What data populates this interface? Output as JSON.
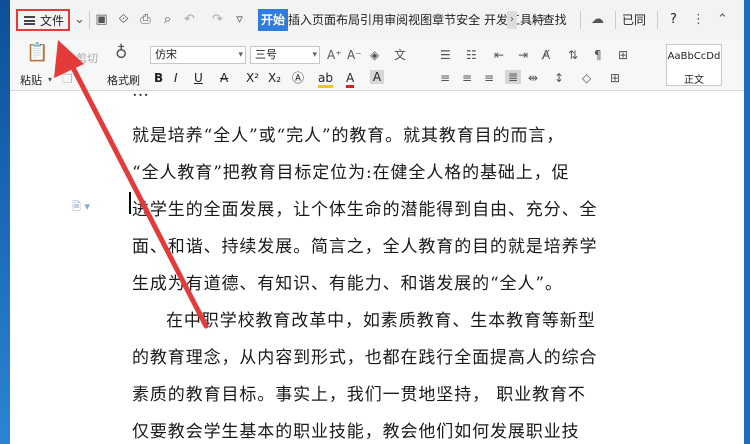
{
  "menubar": {
    "file_label": "文件",
    "tabs": [
      "插入",
      "页面布局",
      "引用",
      "审阅",
      "视图",
      "章节",
      "安全",
      "开发工具",
      "特"
    ],
    "active_tab": "开始",
    "search_label": "查找",
    "sync_label": "已同",
    "help": "?",
    "icons": [
      "menu-icon",
      "save-icon",
      "template-icon",
      "print-icon",
      "preview-icon",
      "undo-icon",
      "redo-icon",
      "more-icon"
    ]
  },
  "ribbon": {
    "paste_label": "粘贴",
    "cut_label": "剪切",
    "format_painter_label": "格式刷",
    "font_name": "仿宋",
    "font_size": "三号",
    "style_sample": "AaBbCcDd",
    "style_name": "正文"
  },
  "document": {
    "lines": [
      "就是培养“全人”或“完人”的教育。就其教育目的而言，",
      "“全人教育”把教育目标定位为:在健全人格的基础上，促",
      "进学生的全面发展，让个体生命的潜能得到自由、充分、全",
      "面、和谐、持续发展。简言之，全人教育的目的就是培养学",
      "生成为有道德、有知识、有能力、和谐发展的“全人”。",
      "在中职学校教育改革中，如素质教育、生本教育等新型",
      "的教育理念，从内容到形式，也都在践行全面提高人的综合",
      "素质的教育目标。事实上，我们一贯地坚持，  职业教育不",
      "仅要教会学生基本的职业技能，教会他们如何发展职业技"
    ]
  },
  "colors": {
    "accent": "#2f7be0",
    "annotation": "#e53a3a"
  }
}
